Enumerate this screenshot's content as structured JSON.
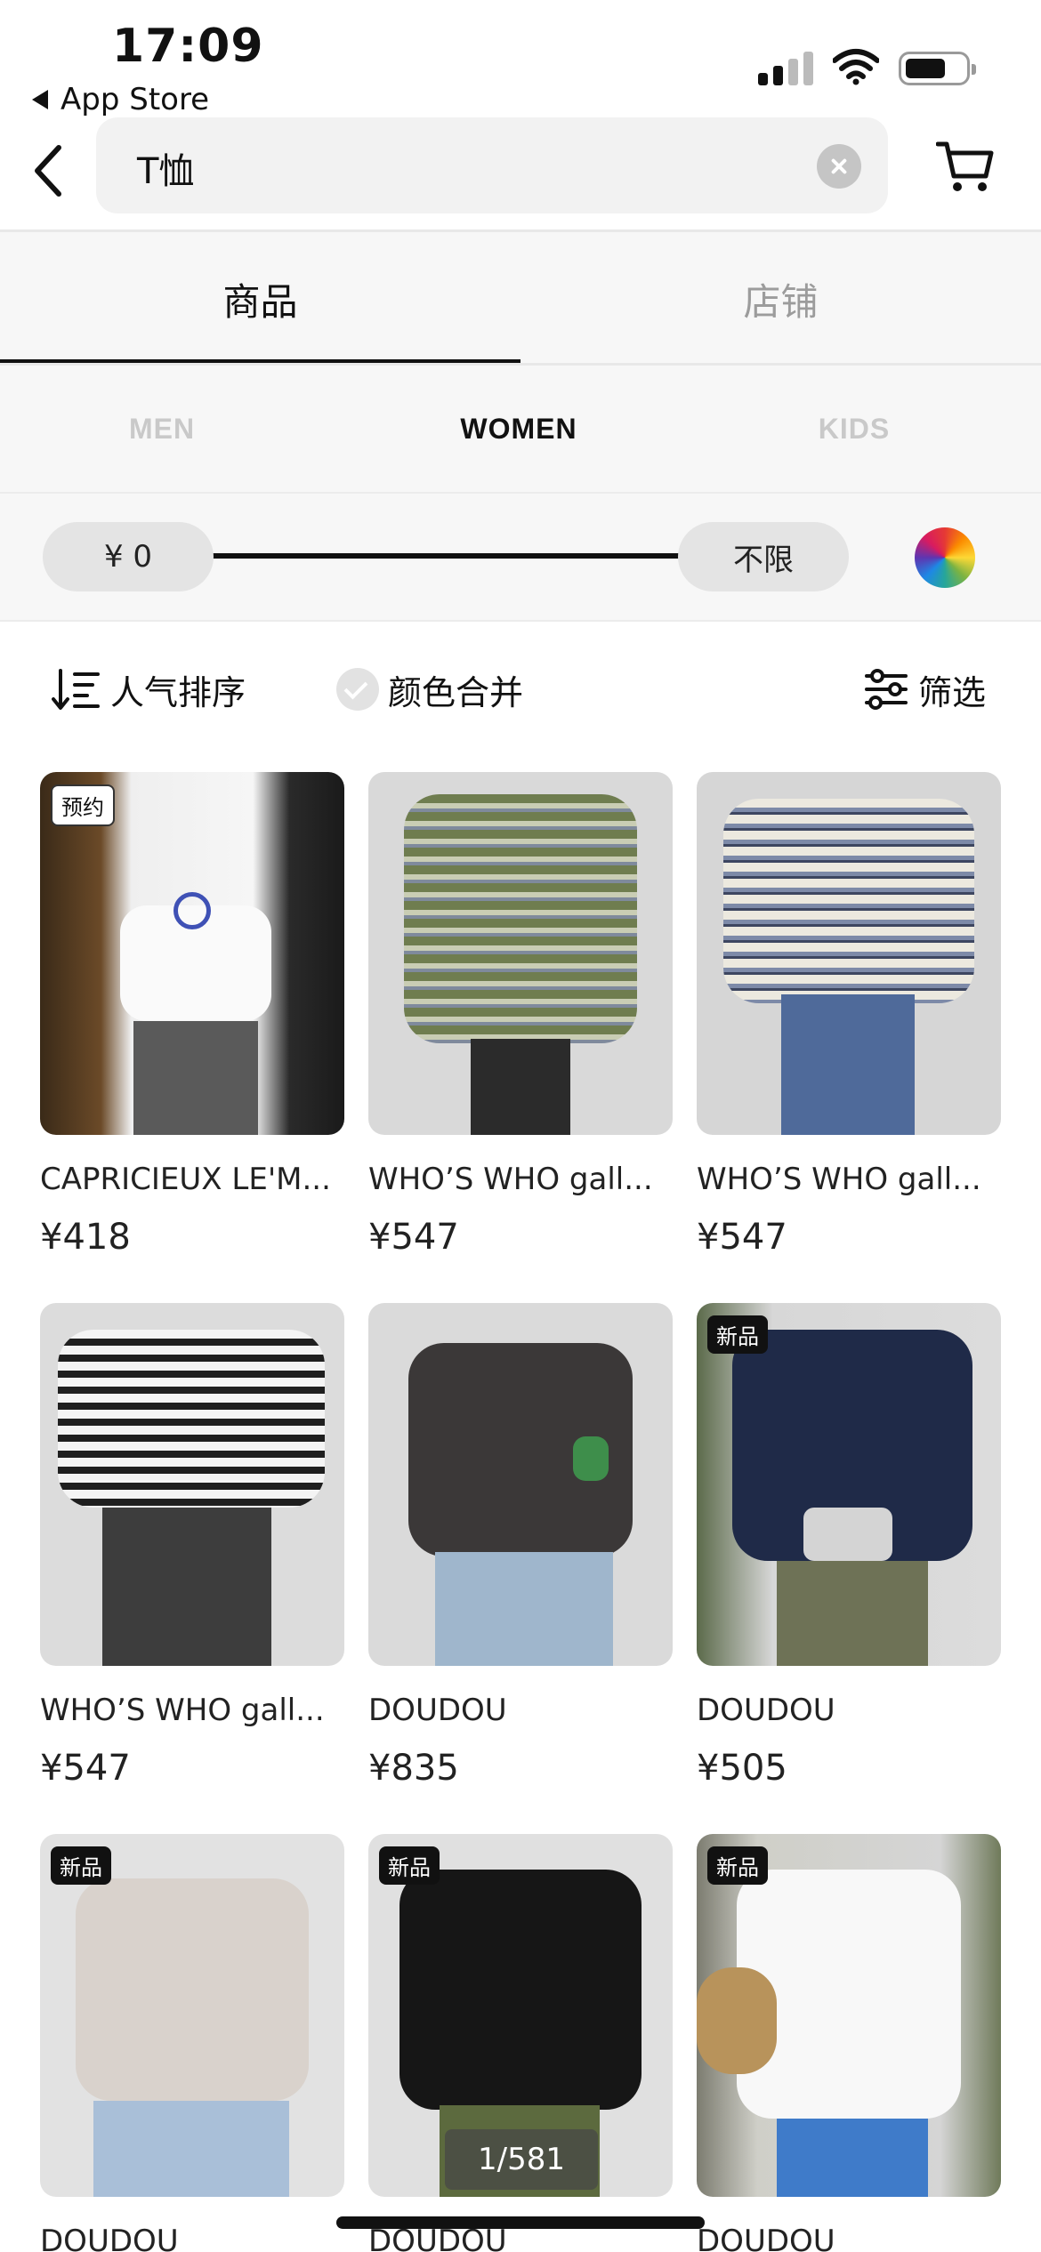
{
  "status_bar": {
    "time": "17:09",
    "back_app": "App Store",
    "icons": [
      "cellular-signal-icon",
      "wifi-icon",
      "battery-icon"
    ]
  },
  "search": {
    "query": "T恤",
    "icons": [
      "back-chevron-icon",
      "clear-icon",
      "cart-icon"
    ]
  },
  "tabs": [
    {
      "label": "商品",
      "active": true
    },
    {
      "label": "店铺",
      "active": false
    }
  ],
  "gender": [
    {
      "label": "MEN",
      "active": false
    },
    {
      "label": "WOMEN",
      "active": true
    },
    {
      "label": "KIDS",
      "active": false
    }
  ],
  "price_filter": {
    "min_label": "¥ 0",
    "max_label": "不限",
    "color_icon": "color-wheel-icon"
  },
  "sort": {
    "popular_label": "人气排序",
    "merge_color_label": "颜色合并",
    "filter_label": "筛选"
  },
  "products": [
    {
      "name": "CAPRICIEUX LE'M...",
      "price": "¥418",
      "badge": "预约",
      "badge_style": "light"
    },
    {
      "name": "WHO’S WHO gall...",
      "price": "¥547",
      "badge": "",
      "badge_style": ""
    },
    {
      "name": "WHO’S WHO gall...",
      "price": "¥547",
      "badge": "",
      "badge_style": ""
    },
    {
      "name": "WHO’S WHO gall...",
      "price": "¥547",
      "badge": "",
      "badge_style": ""
    },
    {
      "name": "DOUDOU",
      "price": "¥835",
      "badge": "",
      "badge_style": ""
    },
    {
      "name": "DOUDOU",
      "price": "¥505",
      "badge": "新品",
      "badge_style": "dark"
    },
    {
      "name": "DOUDOU",
      "price": "",
      "badge": "新品",
      "badge_style": "dark"
    },
    {
      "name": "DOUDOU",
      "price": "",
      "badge": "新品",
      "badge_style": "dark"
    },
    {
      "name": "DOUDOU",
      "price": "",
      "badge": "新品",
      "badge_style": "dark"
    }
  ],
  "pagination": "1/581"
}
